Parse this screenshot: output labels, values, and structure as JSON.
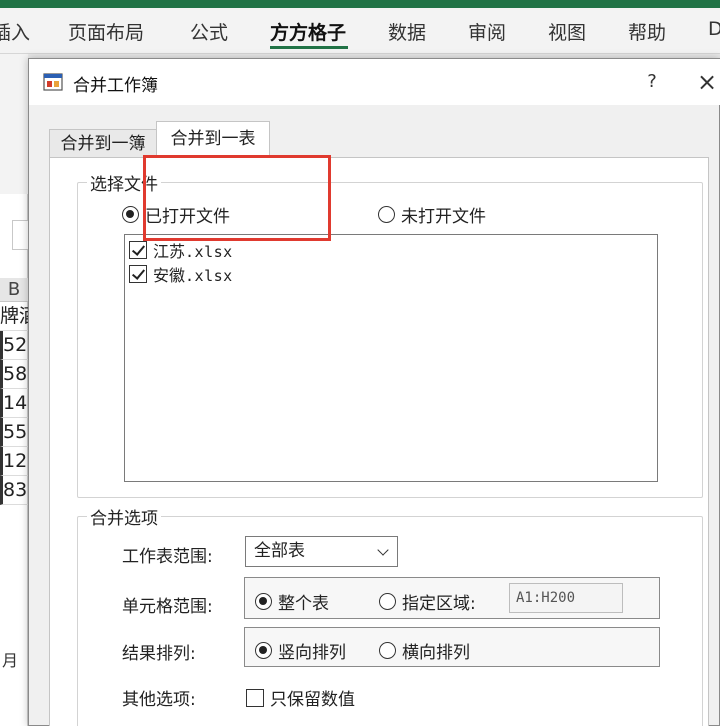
{
  "ribbon": {
    "tabs": [
      {
        "label": "插入",
        "visible_text": "插入",
        "active": false
      },
      {
        "label": "页面布局",
        "active": false
      },
      {
        "label": "公式",
        "active": false
      },
      {
        "label": "方方格子",
        "active": true
      },
      {
        "label": "数据",
        "active": false
      },
      {
        "label": "审阅",
        "active": false
      },
      {
        "label": "视图",
        "active": false
      },
      {
        "label": "帮助",
        "active": false
      }
    ],
    "accent_color": "#217346"
  },
  "sheet": {
    "column_header": "B",
    "cells": [
      "牌酒",
      "52",
      "58",
      "14",
      "55",
      "12",
      "83"
    ],
    "bottom_label": "月"
  },
  "dialog": {
    "title": "合并工作簿",
    "help_label": "?",
    "close_label": "×",
    "tabs": [
      {
        "label": "合并到一簿",
        "active": false
      },
      {
        "label": "合并到一表",
        "active": true
      }
    ],
    "highlight_color": "#e03a2f",
    "select_files": {
      "group_title": "选择文件",
      "options": [
        {
          "label": "已打开文件",
          "selected": true
        },
        {
          "label": "未打开文件",
          "selected": false
        }
      ],
      "files": [
        {
          "name": "江苏",
          "ext": ".xlsx",
          "checked": true
        },
        {
          "name": "安徽",
          "ext": ".xlsx",
          "checked": true
        }
      ]
    },
    "merge_options": {
      "group_title": "合并选项",
      "sheet_range": {
        "label": "工作表范围:",
        "value": "全部表"
      },
      "cell_range": {
        "label": "单元格范围:",
        "options": [
          {
            "label": "整个表",
            "selected": true
          },
          {
            "label": "指定区域:",
            "selected": false
          }
        ],
        "range_value": "A1:H200"
      },
      "result_order": {
        "label": "结果排列:",
        "options": [
          {
            "label": "竖向排列",
            "selected": true
          },
          {
            "label": "横向排列",
            "selected": false
          }
        ]
      },
      "other": {
        "label": "其他选项:",
        "checkbox_label": "只保留数值",
        "checked": false
      }
    }
  }
}
